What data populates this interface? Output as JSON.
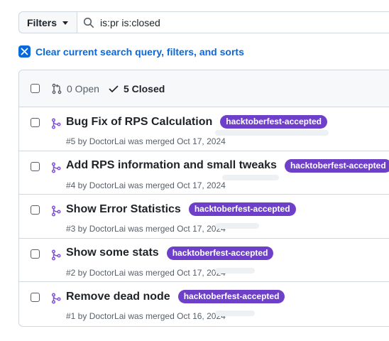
{
  "filter_bar": {
    "filters_label": "Filters",
    "query": "is:pr is:closed"
  },
  "clear_query_label": "Clear current search query, filters, and sorts",
  "list_header": {
    "open_label": "0 Open",
    "closed_label": "5 Closed"
  },
  "label_color": "#6e40c9",
  "pull_requests": [
    {
      "title": "Bug Fix of RPS Calculation",
      "label": "hacktoberfest-accepted",
      "meta": "#5 by DoctorLai was merged Oct 17, 2024"
    },
    {
      "title": "Add RPS information and small tweaks",
      "label": "hacktoberfest-accepted",
      "meta": "#4 by DoctorLai was merged Oct 17, 2024"
    },
    {
      "title": "Show Error Statistics",
      "label": "hacktoberfest-accepted",
      "meta": "#3 by DoctorLai was merged Oct 17, 2024"
    },
    {
      "title": "Show some stats",
      "label": "hacktoberfest-accepted",
      "meta": "#2 by DoctorLai was merged Oct 17, 2024"
    },
    {
      "title": "Remove dead node",
      "label": "hacktoberfest-accepted",
      "meta": "#1 by DoctorLai was merged Oct 16, 2024"
    }
  ]
}
